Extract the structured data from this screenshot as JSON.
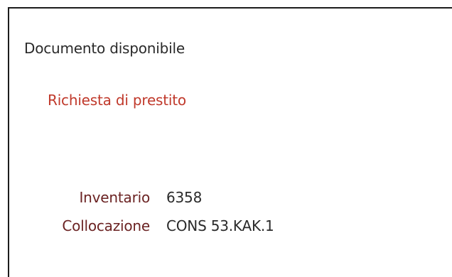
{
  "status": {
    "availability": "Documento disponibile"
  },
  "actions": {
    "loan_request": "Richiesta di prestito"
  },
  "details": [
    {
      "label": "Inventario",
      "value": "6358"
    },
    {
      "label": "Collocazione",
      "value": "CONS 53.KAK.1"
    }
  ],
  "colors": {
    "link": "#c0392b",
    "label": "#6b2323",
    "text": "#2a2a2a",
    "border": "#1c1c1c"
  }
}
